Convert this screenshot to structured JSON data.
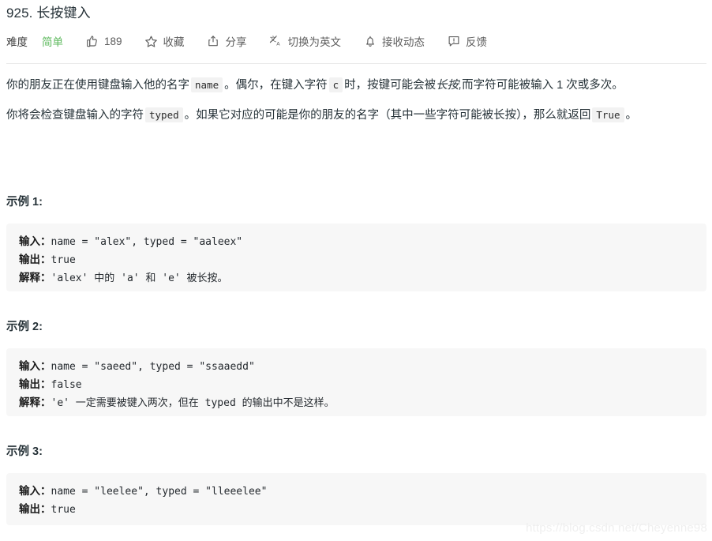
{
  "problem": {
    "number": "925.",
    "title": "长按键入",
    "full_title": "925. 长按键入"
  },
  "toolbar": {
    "difficulty_label": "难度",
    "difficulty_value": "简单",
    "difficulty_color": "#5cb85c",
    "like_icon": "thumbs-up-icon",
    "like_count": "189",
    "favorite_icon": "star-icon",
    "favorite_label": "收藏",
    "share_icon": "share-icon",
    "share_label": "分享",
    "translate_icon": "translate-icon",
    "translate_label": "切换为英文",
    "notify_icon": "bell-icon",
    "notify_label": "接收动态",
    "feedback_icon": "feedback-icon",
    "feedback_label": "反馈"
  },
  "description": {
    "p1_a": "你的朋友正在使用键盘输入他的名字",
    "p1_code1": "name",
    "p1_b": "。偶尔，在键入字符",
    "p1_code2": "c",
    "p1_c": "时，按键可能会被",
    "p1_em": "长按,",
    "p1_d": "而字符可能被输入 1 次或多次。",
    "p2_a": "你将会检查键盘输入的字符",
    "p2_code1": "typed",
    "p2_b": "。如果它对应的可能是你的朋友的名字（其中一些字符可能被长按），那么就返回",
    "p2_code2": "True",
    "p2_c": "。"
  },
  "examples": [
    {
      "heading": "示例 1:",
      "input_label": "输入：",
      "input_value": "name = \"alex\", typed = \"aaleex\"",
      "output_label": "输出：",
      "output_value": "true",
      "explain_label": "解释：",
      "explain_value": "'alex' 中的 'a' 和 'e' 被长按。"
    },
    {
      "heading": "示例 2:",
      "input_label": "输入：",
      "input_value": "name = \"saeed\", typed = \"ssaaedd\"",
      "output_label": "输出：",
      "output_value": "false",
      "explain_label": "解释：",
      "explain_value": "'e' 一定需要被键入两次，但在 typed 的输出中不是这样。"
    },
    {
      "heading": "示例 3:",
      "input_label": "输入：",
      "input_value": "name = \"leelee\", typed = \"lleeelee\"",
      "output_label": "输出：",
      "output_value": "true"
    }
  ],
  "watermark": "https://blog.csdn.net/Cheyenne98"
}
